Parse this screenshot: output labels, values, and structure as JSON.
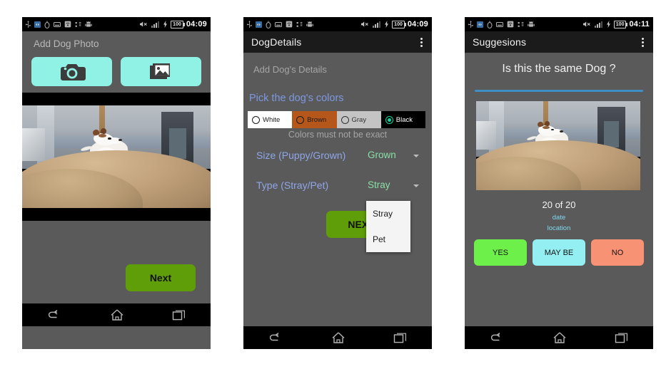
{
  "meta": {
    "screens_count": 3,
    "background": "#ffffff"
  },
  "colors": {
    "screen_bg": "#5a5a5a",
    "actionbar_bg": "#1b1b1b",
    "statusbar_bg": "#000000",
    "navbar_bg": "#000000",
    "cyan_button": "#90f2e4",
    "green_button": "#5f9e08",
    "accent_blue_heading": "#7c98e0",
    "field_label_blue": "#8fa6e8",
    "field_value_green": "#8bdfa8",
    "divider_blue": "#3f8fc4",
    "info_cyan": "#7fd8ee",
    "yes_green": "#6ef04a",
    "maybe_cyan": "#93eff2",
    "no_salmon": "#f79274",
    "swatch_white": "#ffffff",
    "swatch_brown": "#b5561a",
    "swatch_gray": "#c4c4c4",
    "swatch_black": "#000000",
    "radio_selected_teal": "#0fd6a0"
  },
  "statusbar": {
    "icons": [
      "usb-icon",
      "developer-icon",
      "alarm-icon",
      "screenshot-icon",
      "wifi-hotspot-icon",
      "usb-debug-icon",
      "android-icon"
    ],
    "right_icons": [
      "mute-icon",
      "signal-icon",
      "charging-icon"
    ],
    "battery_level": "100",
    "time_screen1": "04:09",
    "time_screen2": "04:09",
    "time_screen3": "04:11"
  },
  "navbar": {
    "back_label": "back-icon",
    "home_label": "home-icon",
    "recents_label": "recents-icon"
  },
  "screen1": {
    "title": "Add Dog Photo",
    "camera_button": "camera-icon",
    "gallery_button": "gallery-icon",
    "photo_alt": "Photo of a white and brown dog sitting on a sand pile",
    "next_label": "Next"
  },
  "screen2": {
    "app_title": "DogDetails",
    "subtitle": "Add Dog's Details",
    "colors_heading": "Pick the dog's colors",
    "color_options": [
      {
        "label": "White",
        "selected": false
      },
      {
        "label": "Brown",
        "selected": false
      },
      {
        "label": "Gray",
        "selected": false
      },
      {
        "label": "Black",
        "selected": true
      }
    ],
    "note": "Colors must not be exact",
    "fields": [
      {
        "label": "Size (Puppy/Grown)",
        "value": "Grown"
      },
      {
        "label": "Type (Stray/Pet)",
        "value": "Stray"
      }
    ],
    "next_label": "NEXT",
    "dropdown": {
      "open": true,
      "options": [
        "Stray",
        "Pet"
      ]
    }
  },
  "screen3": {
    "app_title": "Suggesions",
    "question": "Is this the same Dog ?",
    "photo_alt": "Photo of a white and brown dog sitting on a sand pile",
    "counter": "20 of 20",
    "date": "date",
    "location": "location",
    "buttons": [
      {
        "label": "YES"
      },
      {
        "label": "MAY BE"
      },
      {
        "label": "NO"
      }
    ]
  }
}
